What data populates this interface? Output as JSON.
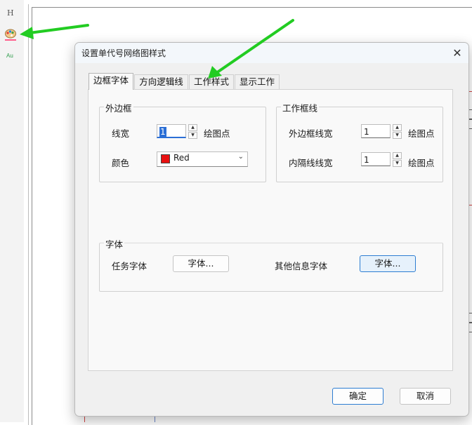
{
  "toolbar": {
    "h_label": "H",
    "au_label": "Au"
  },
  "dialog": {
    "title": "设置单代号网络图样式",
    "close_glyph": "✕",
    "tabs": [
      "边框字体",
      "方向逻辑线",
      "工作样式",
      "显示工作"
    ],
    "outer_border": {
      "legend": "外边框",
      "line_width_label": "线宽",
      "line_width_value": "1",
      "line_width_unit": "绘图点",
      "color_label": "颜色",
      "color_value": "Red",
      "color_hex": "#e81010"
    },
    "work_frame": {
      "legend": "工作框线",
      "outer_width_label": "外边框线宽",
      "outer_width_value": "1",
      "outer_width_unit": "绘图点",
      "inner_width_label": "内隔线线宽",
      "inner_width_value": "1",
      "inner_width_unit": "绘图点"
    },
    "font": {
      "legend": "字体",
      "task_font_label": "任务字体",
      "task_font_button": "字体...",
      "other_font_label": "其他信息字体",
      "other_font_button": "字体..."
    },
    "ok_button": "确定",
    "cancel_button": "取消"
  },
  "colors": {
    "annotation_arrow": "#22cc22",
    "accent": "#2d7dd2"
  }
}
